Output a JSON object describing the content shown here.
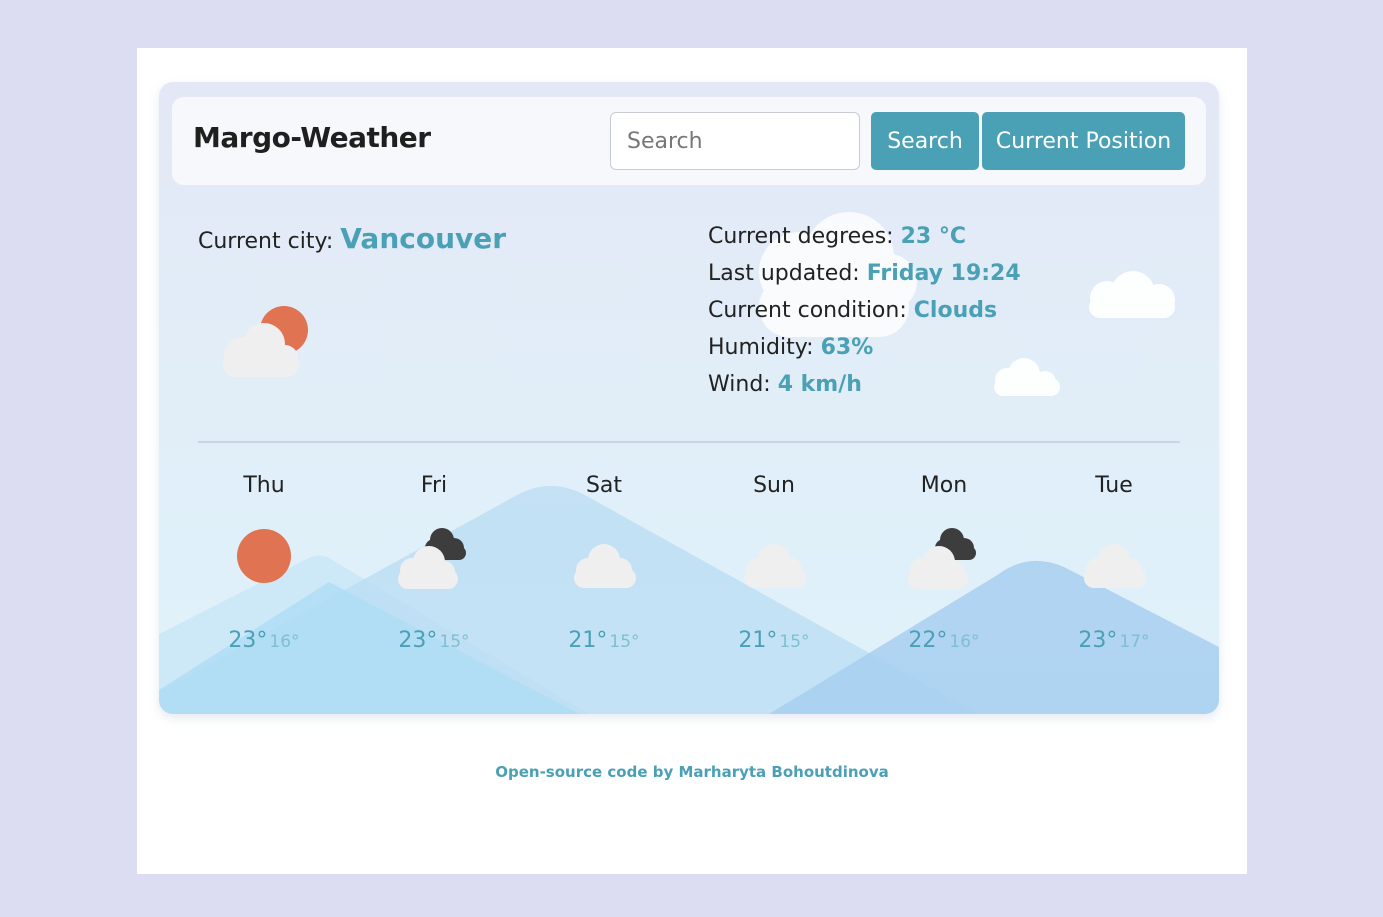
{
  "app": {
    "title": "Margo-Weather"
  },
  "search": {
    "placeholder": "Search",
    "button_label": "Search",
    "current_label": "Current Position"
  },
  "current": {
    "city_label": "Current city:",
    "city": "Vancouver",
    "icon": "sun-behind-cloud-icon",
    "stats": [
      {
        "label": "Current degrees:",
        "value": "23 °C"
      },
      {
        "label": "Last updated:",
        "value": "Friday 19:24"
      },
      {
        "label": "Current condition:",
        "value": "Clouds"
      },
      {
        "label": "Humidity:",
        "value": "63%"
      },
      {
        "label": "Wind:",
        "value": "4 km/h"
      }
    ]
  },
  "forecast": [
    {
      "day": "Thu",
      "icon": "sun-icon",
      "hi": "23°",
      "lo": "16°"
    },
    {
      "day": "Fri",
      "icon": "cloud-dark-cloud-icon",
      "hi": "23°",
      "lo": "15°"
    },
    {
      "day": "Sat",
      "icon": "cloud-icon",
      "hi": "21°",
      "lo": "15°"
    },
    {
      "day": "Sun",
      "icon": "cloud-icon",
      "hi": "21°",
      "lo": "15°"
    },
    {
      "day": "Mon",
      "icon": "cloud-dark-cloud-icon",
      "hi": "22°",
      "lo": "16°"
    },
    {
      "day": "Tue",
      "icon": "cloud-icon",
      "hi": "23°",
      "lo": "17°"
    }
  ],
  "footer": {
    "text": "Open-source code by Marharyta Bohoutdinova"
  },
  "colors": {
    "accent": "#4aa0b5",
    "sun": "#e07352",
    "page_bg": "#dcdcf2"
  }
}
